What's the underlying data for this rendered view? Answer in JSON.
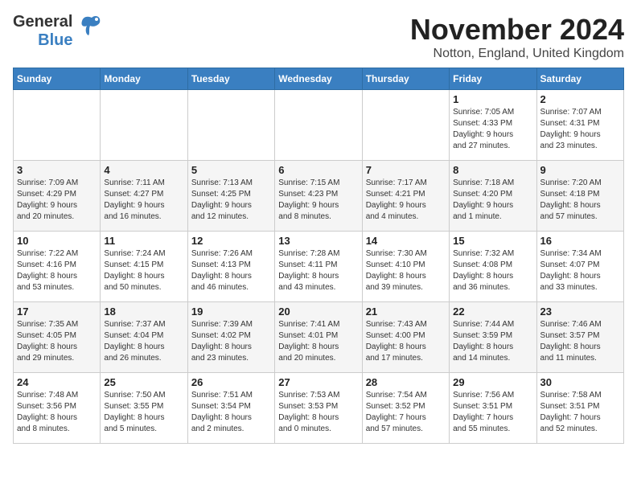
{
  "header": {
    "logo_general": "General",
    "logo_blue": "Blue",
    "month_title": "November 2024",
    "location": "Notton, England, United Kingdom"
  },
  "days_of_week": [
    "Sunday",
    "Monday",
    "Tuesday",
    "Wednesday",
    "Thursday",
    "Friday",
    "Saturday"
  ],
  "weeks": [
    [
      {
        "day": "",
        "info": ""
      },
      {
        "day": "",
        "info": ""
      },
      {
        "day": "",
        "info": ""
      },
      {
        "day": "",
        "info": ""
      },
      {
        "day": "",
        "info": ""
      },
      {
        "day": "1",
        "info": "Sunrise: 7:05 AM\nSunset: 4:33 PM\nDaylight: 9 hours\nand 27 minutes."
      },
      {
        "day": "2",
        "info": "Sunrise: 7:07 AM\nSunset: 4:31 PM\nDaylight: 9 hours\nand 23 minutes."
      }
    ],
    [
      {
        "day": "3",
        "info": "Sunrise: 7:09 AM\nSunset: 4:29 PM\nDaylight: 9 hours\nand 20 minutes."
      },
      {
        "day": "4",
        "info": "Sunrise: 7:11 AM\nSunset: 4:27 PM\nDaylight: 9 hours\nand 16 minutes."
      },
      {
        "day": "5",
        "info": "Sunrise: 7:13 AM\nSunset: 4:25 PM\nDaylight: 9 hours\nand 12 minutes."
      },
      {
        "day": "6",
        "info": "Sunrise: 7:15 AM\nSunset: 4:23 PM\nDaylight: 9 hours\nand 8 minutes."
      },
      {
        "day": "7",
        "info": "Sunrise: 7:17 AM\nSunset: 4:21 PM\nDaylight: 9 hours\nand 4 minutes."
      },
      {
        "day": "8",
        "info": "Sunrise: 7:18 AM\nSunset: 4:20 PM\nDaylight: 9 hours\nand 1 minute."
      },
      {
        "day": "9",
        "info": "Sunrise: 7:20 AM\nSunset: 4:18 PM\nDaylight: 8 hours\nand 57 minutes."
      }
    ],
    [
      {
        "day": "10",
        "info": "Sunrise: 7:22 AM\nSunset: 4:16 PM\nDaylight: 8 hours\nand 53 minutes."
      },
      {
        "day": "11",
        "info": "Sunrise: 7:24 AM\nSunset: 4:15 PM\nDaylight: 8 hours\nand 50 minutes."
      },
      {
        "day": "12",
        "info": "Sunrise: 7:26 AM\nSunset: 4:13 PM\nDaylight: 8 hours\nand 46 minutes."
      },
      {
        "day": "13",
        "info": "Sunrise: 7:28 AM\nSunset: 4:11 PM\nDaylight: 8 hours\nand 43 minutes."
      },
      {
        "day": "14",
        "info": "Sunrise: 7:30 AM\nSunset: 4:10 PM\nDaylight: 8 hours\nand 39 minutes."
      },
      {
        "day": "15",
        "info": "Sunrise: 7:32 AM\nSunset: 4:08 PM\nDaylight: 8 hours\nand 36 minutes."
      },
      {
        "day": "16",
        "info": "Sunrise: 7:34 AM\nSunset: 4:07 PM\nDaylight: 8 hours\nand 33 minutes."
      }
    ],
    [
      {
        "day": "17",
        "info": "Sunrise: 7:35 AM\nSunset: 4:05 PM\nDaylight: 8 hours\nand 29 minutes."
      },
      {
        "day": "18",
        "info": "Sunrise: 7:37 AM\nSunset: 4:04 PM\nDaylight: 8 hours\nand 26 minutes."
      },
      {
        "day": "19",
        "info": "Sunrise: 7:39 AM\nSunset: 4:02 PM\nDaylight: 8 hours\nand 23 minutes."
      },
      {
        "day": "20",
        "info": "Sunrise: 7:41 AM\nSunset: 4:01 PM\nDaylight: 8 hours\nand 20 minutes."
      },
      {
        "day": "21",
        "info": "Sunrise: 7:43 AM\nSunset: 4:00 PM\nDaylight: 8 hours\nand 17 minutes."
      },
      {
        "day": "22",
        "info": "Sunrise: 7:44 AM\nSunset: 3:59 PM\nDaylight: 8 hours\nand 14 minutes."
      },
      {
        "day": "23",
        "info": "Sunrise: 7:46 AM\nSunset: 3:57 PM\nDaylight: 8 hours\nand 11 minutes."
      }
    ],
    [
      {
        "day": "24",
        "info": "Sunrise: 7:48 AM\nSunset: 3:56 PM\nDaylight: 8 hours\nand 8 minutes."
      },
      {
        "day": "25",
        "info": "Sunrise: 7:50 AM\nSunset: 3:55 PM\nDaylight: 8 hours\nand 5 minutes."
      },
      {
        "day": "26",
        "info": "Sunrise: 7:51 AM\nSunset: 3:54 PM\nDaylight: 8 hours\nand 2 minutes."
      },
      {
        "day": "27",
        "info": "Sunrise: 7:53 AM\nSunset: 3:53 PM\nDaylight: 8 hours\nand 0 minutes."
      },
      {
        "day": "28",
        "info": "Sunrise: 7:54 AM\nSunset: 3:52 PM\nDaylight: 7 hours\nand 57 minutes."
      },
      {
        "day": "29",
        "info": "Sunrise: 7:56 AM\nSunset: 3:51 PM\nDaylight: 7 hours\nand 55 minutes."
      },
      {
        "day": "30",
        "info": "Sunrise: 7:58 AM\nSunset: 3:51 PM\nDaylight: 7 hours\nand 52 minutes."
      }
    ]
  ]
}
